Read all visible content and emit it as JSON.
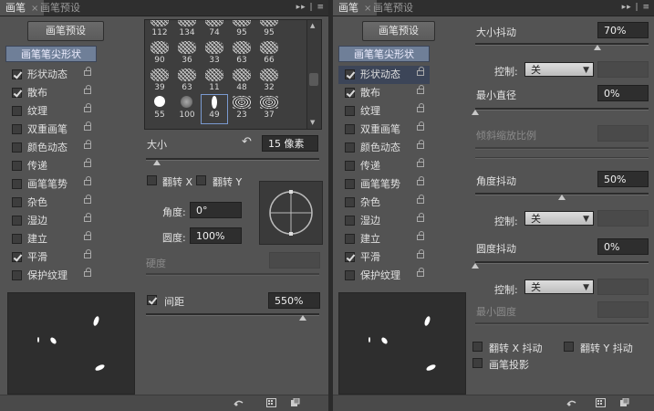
{
  "left_panel": {
    "tabs": [
      {
        "label": "画笔",
        "active": true
      },
      {
        "label": "画笔预设",
        "active": false
      }
    ],
    "preset_button": "画笔预设",
    "tip_shape_label": "画笔笔尖形状",
    "options": [
      {
        "label": "形状动态",
        "checked": true
      },
      {
        "label": "散布",
        "checked": true
      },
      {
        "label": "纹理",
        "checked": false
      },
      {
        "label": "双重画笔",
        "checked": false
      },
      {
        "label": "颜色动态",
        "checked": false
      },
      {
        "label": "传递",
        "checked": false
      },
      {
        "label": "画笔笔势",
        "checked": false
      },
      {
        "label": "杂色",
        "checked": false
      },
      {
        "label": "湿边",
        "checked": false
      },
      {
        "label": "建立",
        "checked": false
      },
      {
        "label": "平滑",
        "checked": true
      },
      {
        "label": "保护纹理",
        "checked": false
      }
    ],
    "tips": [
      "112",
      "134",
      "74",
      "95",
      "95",
      "90",
      "36",
      "33",
      "63",
      "66",
      "39",
      "63",
      "11",
      "48",
      "32",
      "55",
      "100",
      "49",
      "23",
      "37"
    ],
    "selected_tip": "49",
    "size_label": "大小",
    "size_value": "15 像素",
    "flip_x": "翻转 X",
    "flip_y": "翻转 Y",
    "angle_label": "角度:",
    "angle_value": "0°",
    "roundness_label": "圆度:",
    "roundness_value": "100%",
    "hardness_label": "硬度",
    "spacing_label": "间距",
    "spacing_checked": true,
    "spacing_value": "550%"
  },
  "right_panel": {
    "tabs": [
      {
        "label": "画笔",
        "active": true
      },
      {
        "label": "画笔预设",
        "active": false
      }
    ],
    "preset_button": "画笔预设",
    "tip_shape_label": "画笔笔尖形状",
    "options": [
      {
        "label": "形状动态",
        "checked": true
      },
      {
        "label": "散布",
        "checked": true
      },
      {
        "label": "纹理",
        "checked": false
      },
      {
        "label": "双重画笔",
        "checked": false
      },
      {
        "label": "颜色动态",
        "checked": false
      },
      {
        "label": "传递",
        "checked": false
      },
      {
        "label": "画笔笔势",
        "checked": false
      },
      {
        "label": "杂色",
        "checked": false
      },
      {
        "label": "湿边",
        "checked": false
      },
      {
        "label": "建立",
        "checked": false
      },
      {
        "label": "平滑",
        "checked": true
      },
      {
        "label": "保护纹理",
        "checked": false
      }
    ],
    "size_jitter_label": "大小抖动",
    "size_jitter_value": "70%",
    "control_label": "控制:",
    "control_value": "关",
    "min_diameter_label": "最小直径",
    "min_diameter_value": "0%",
    "tilt_scale_label": "倾斜缩放比例",
    "angle_jitter_label": "角度抖动",
    "angle_jitter_value": "50%",
    "roundness_jitter_label": "圆度抖动",
    "roundness_jitter_value": "0%",
    "min_roundness_label": "最小圆度",
    "flip_x_jitter": "翻转 X 抖动",
    "flip_y_jitter": "翻转 Y 抖动",
    "brush_projection": "画笔投影"
  }
}
